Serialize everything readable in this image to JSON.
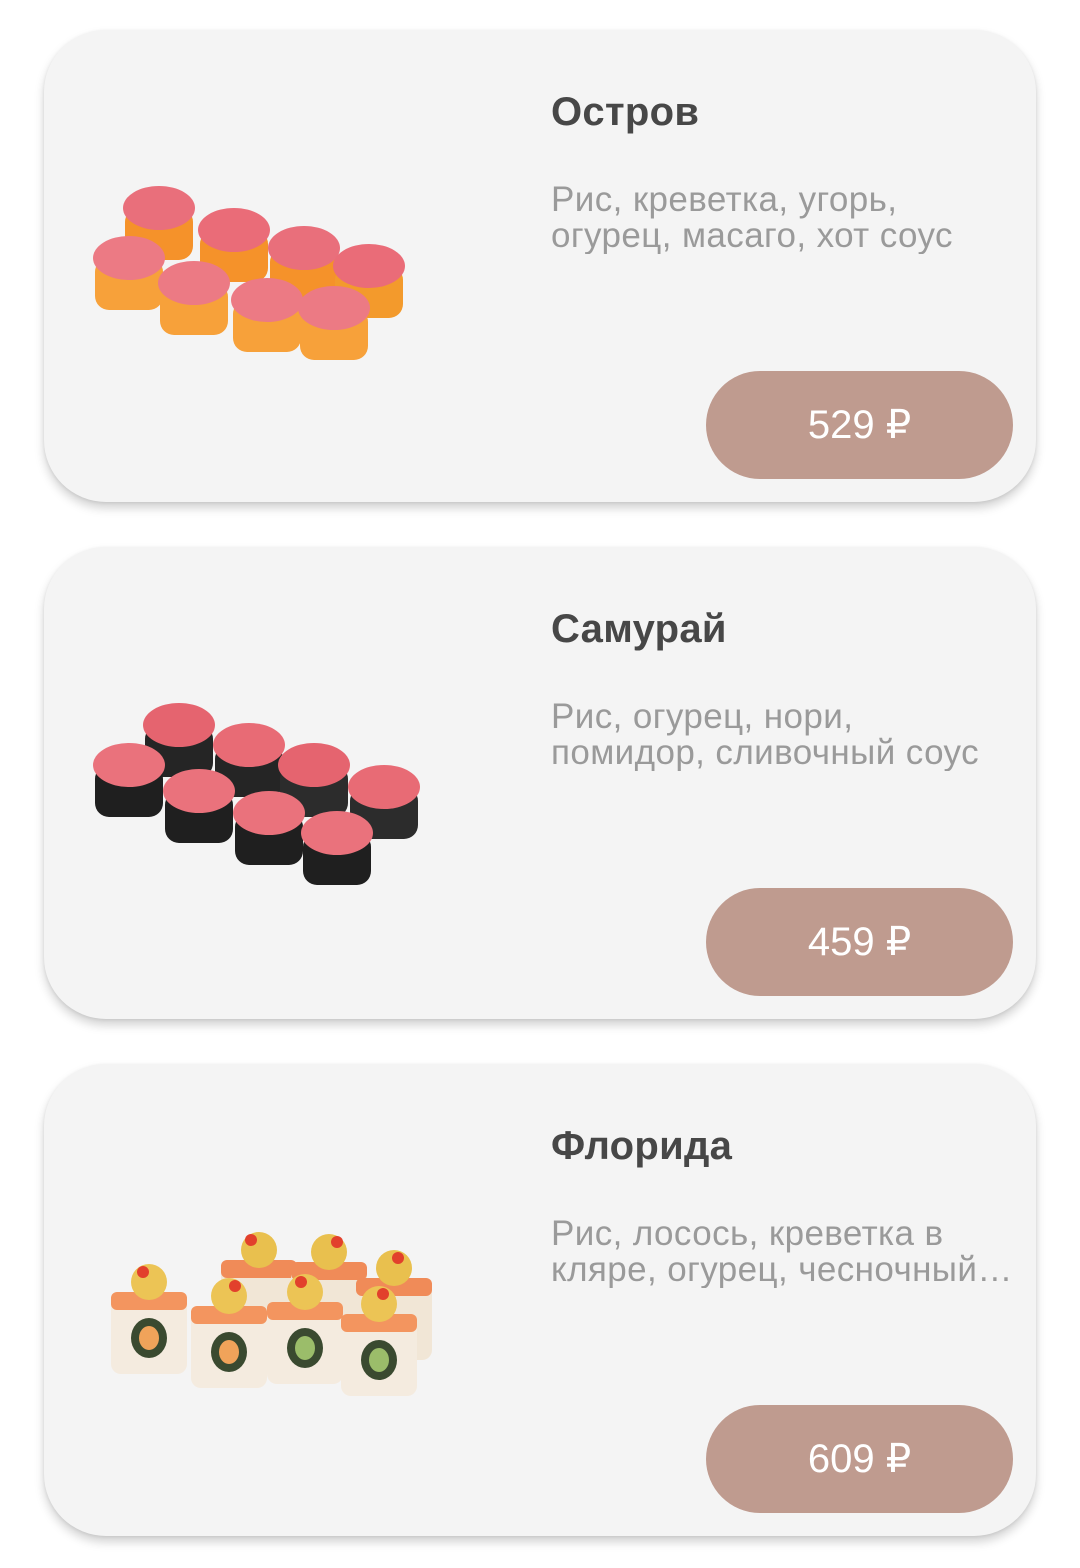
{
  "products": [
    {
      "title": "Остров",
      "description": "Рис, креветка, угорь, огурец, масаго, хот соус",
      "price": "529 ₽",
      "image_icon": "sushi-roll-masago-image",
      "colors": {
        "base": "#f59a2e",
        "top": "#e8707c"
      }
    },
    {
      "title": "Самурай",
      "description": "Рис, огурец, нори, помидор, сливочный соус",
      "price": "459 ₽",
      "image_icon": "sushi-roll-nori-image",
      "colors": {
        "base": "#2a2a2a",
        "top": "#e5646f"
      }
    },
    {
      "title": "Флорида",
      "description": "Рис, лосось, креветка в кляре, огурец, чесночный соус",
      "price": "609 ₽",
      "image_icon": "sushi-roll-florida-image",
      "colors": {
        "base": "#f1e6d6",
        "top": "#f08b58"
      }
    }
  ],
  "colors": {
    "card_background": "#f4f4f4",
    "price_button": "#bf9b8f",
    "title_text": "#474747",
    "description_text": "#9a9a9a"
  }
}
